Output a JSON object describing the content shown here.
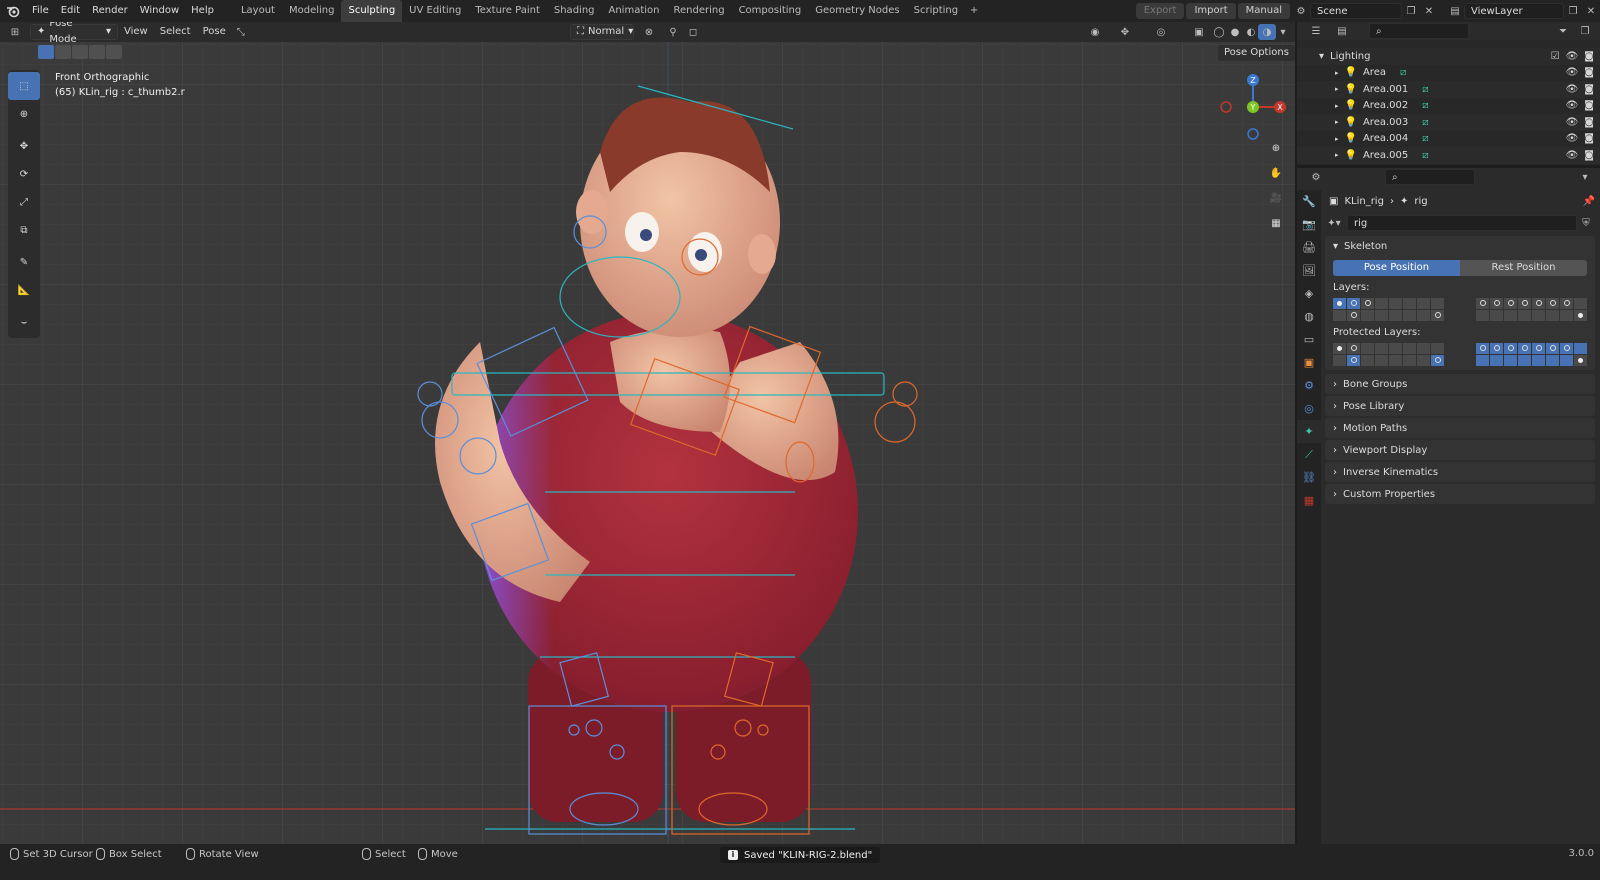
{
  "menu": [
    "File",
    "Edit",
    "Render",
    "Window",
    "Help"
  ],
  "workspaces": [
    "Layout",
    "Modeling",
    "Sculpting",
    "UV Editing",
    "Texture Paint",
    "Shading",
    "Animation",
    "Rendering",
    "Compositing",
    "Geometry Nodes",
    "Scripting"
  ],
  "active_workspace": "Sculpting",
  "topbar": {
    "export": "Export",
    "import": "Import",
    "manual": "Manual",
    "scene": "Scene",
    "viewlayer": "ViewLayer"
  },
  "viewport_header": {
    "mode": "Pose Mode",
    "menus": [
      "View",
      "Select",
      "Pose"
    ],
    "orientation": "Normal",
    "pose_options": "Pose Options"
  },
  "viewport_info": {
    "view_name": "Front Orthographic",
    "object": "(65) KLin_rig : c_thumb2.r"
  },
  "gizmo": {
    "z": "Z",
    "y": "Y",
    "x": "X"
  },
  "outliner": {
    "collection": "Lighting",
    "items": [
      "Area",
      "Area.001",
      "Area.002",
      "Area.003",
      "Area.004",
      "Area.005"
    ]
  },
  "properties": {
    "breadcrumb_object": "KLin_rig",
    "breadcrumb_data": "rig",
    "datablock": "rig",
    "skeleton": {
      "title": "Skeleton",
      "pose_position": "Pose Position",
      "rest_position": "Rest Position",
      "layers_label": "Layers:",
      "protected_label": "Protected Layers:"
    },
    "panels": [
      "Bone Groups",
      "Pose Library",
      "Motion Paths",
      "Viewport Display",
      "Inverse Kinematics",
      "Custom Properties"
    ]
  },
  "statusbar": {
    "set_cursor": "Set 3D Cursor",
    "box_select": "Box Select",
    "rotate_view": "Rotate View",
    "select": "Select",
    "move": "Move",
    "saved_message": "Saved \"KLIN-RIG-2.blend\"",
    "version": "3.0.0"
  },
  "colors": {
    "accent": "#4772b3",
    "bone_left": "#5b8fd9",
    "bone_right": "#e0682a",
    "bone_center": "#2ab6c0",
    "x_axis": "#c0392b",
    "y_axis": "#7ec624",
    "z_axis": "#3a78d4"
  }
}
